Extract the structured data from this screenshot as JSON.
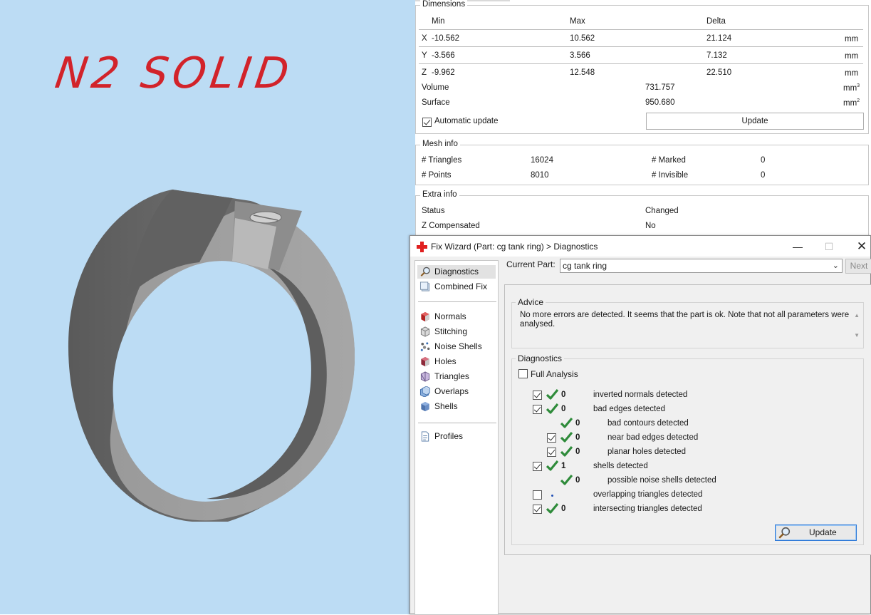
{
  "viewport": {
    "title": "N2 SOLID"
  },
  "dimensions": {
    "title": "Dimensions",
    "headers": {
      "min": "Min",
      "max": "Max",
      "delta": "Delta"
    },
    "rows": [
      {
        "axis": "X",
        "min": "-10.562",
        "max": "10.562",
        "delta": "21.124",
        "unit": "mm"
      },
      {
        "axis": "Y",
        "min": "-3.566",
        "max": "3.566",
        "delta": "7.132",
        "unit": "mm"
      },
      {
        "axis": "Z",
        "min": "-9.962",
        "max": "12.548",
        "delta": "22.510",
        "unit": "mm"
      }
    ],
    "volume": {
      "label": "Volume",
      "value": "731.757",
      "unit": "mm",
      "exp": "3"
    },
    "surface": {
      "label": "Surface",
      "value": "950.680",
      "unit": "mm",
      "exp": "2"
    },
    "auto_update_label": "Automatic update",
    "auto_update_checked": true,
    "update_label": "Update"
  },
  "mesh_info": {
    "title": "Mesh info",
    "triangles_label": "# Triangles",
    "triangles_value": "16024",
    "points_label": "# Points",
    "points_value": "8010",
    "marked_label": "# Marked",
    "marked_value": "0",
    "invisible_label": "# Invisible",
    "invisible_value": "0"
  },
  "extra_info": {
    "title": "Extra info",
    "status_label": "Status",
    "status_value": "Changed",
    "zcomp_label": "Z Compensated",
    "zcomp_value": "No"
  },
  "dialog": {
    "title": "Fix Wizard (Part: cg tank ring) > Diagnostics",
    "nav": {
      "top": [
        "Diagnostics",
        "Combined Fix"
      ],
      "middle": [
        "Normals",
        "Stitching",
        "Noise Shells",
        "Holes",
        "Triangles",
        "Overlaps",
        "Shells"
      ],
      "bottom": [
        "Profiles"
      ],
      "active": "Diagnostics"
    },
    "current_part_label": "Current Part:",
    "current_part_value": "cg tank ring",
    "next_label": "Next",
    "advice_title": "Advice",
    "advice_text": "No more errors are detected. It seems that the part is ok. Note that not all parameters were analysed.",
    "diagnostics_title": "Diagnostics",
    "full_analysis_label": "Full Analysis",
    "items": [
      {
        "count": "0",
        "label": "inverted normals detected",
        "checkbox": true,
        "checked": true,
        "ok": true,
        "indent": 0
      },
      {
        "count": "0",
        "label": "bad edges detected",
        "checkbox": true,
        "checked": true,
        "ok": true,
        "indent": 0
      },
      {
        "count": "0",
        "label": "bad contours detected",
        "checkbox": false,
        "checked": false,
        "ok": true,
        "indent": 1
      },
      {
        "count": "0",
        "label": "near bad edges detected",
        "checkbox": true,
        "checked": true,
        "ok": true,
        "indent": 1
      },
      {
        "count": "0",
        "label": "planar holes detected",
        "checkbox": true,
        "checked": true,
        "ok": true,
        "indent": 1
      },
      {
        "count": "1",
        "label": "shells detected",
        "checkbox": true,
        "checked": true,
        "ok": true,
        "indent": 0
      },
      {
        "count": "0",
        "label": "possible noise shells detected",
        "checkbox": false,
        "checked": false,
        "ok": true,
        "indent": 1
      },
      {
        "count": "",
        "label": "overlapping triangles detected",
        "checkbox": true,
        "checked": false,
        "ok": false,
        "indent": 0
      },
      {
        "count": "0",
        "label": "intersecting triangles detected",
        "checkbox": true,
        "checked": true,
        "ok": true,
        "indent": 0
      }
    ],
    "update_label": "Update"
  },
  "colors": {
    "viewport_bg": "#bcdcf4",
    "title_red": "#d2232a",
    "ok_green": "#2e8b3a",
    "focus_blue": "#2f7ad8"
  }
}
